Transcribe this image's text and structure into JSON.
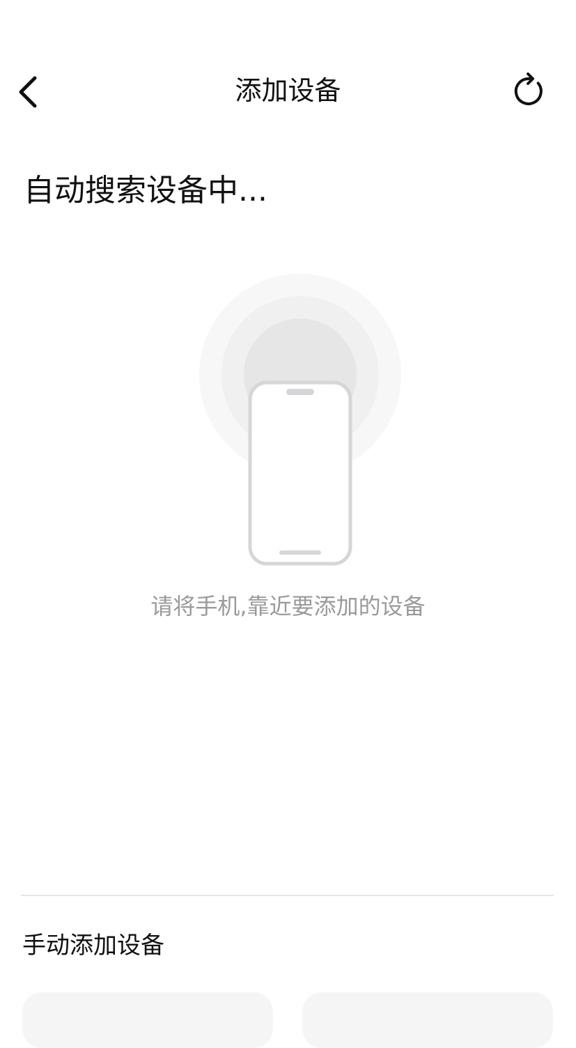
{
  "header": {
    "title": "添加设备",
    "back_icon": "chevron-left-icon",
    "refresh_icon": "refresh-icon"
  },
  "search": {
    "title": "自动搜索设备中..."
  },
  "illustration": {
    "icon": "phone-icon",
    "hint": "请将手机,靠近要添加的设备"
  },
  "manual": {
    "title": "手动添加设备"
  },
  "colors": {
    "text_primary": "#111111",
    "text_secondary": "#9a9a9a",
    "phone_outline": "#d6d6d8",
    "divider": "#e6e6e6"
  }
}
